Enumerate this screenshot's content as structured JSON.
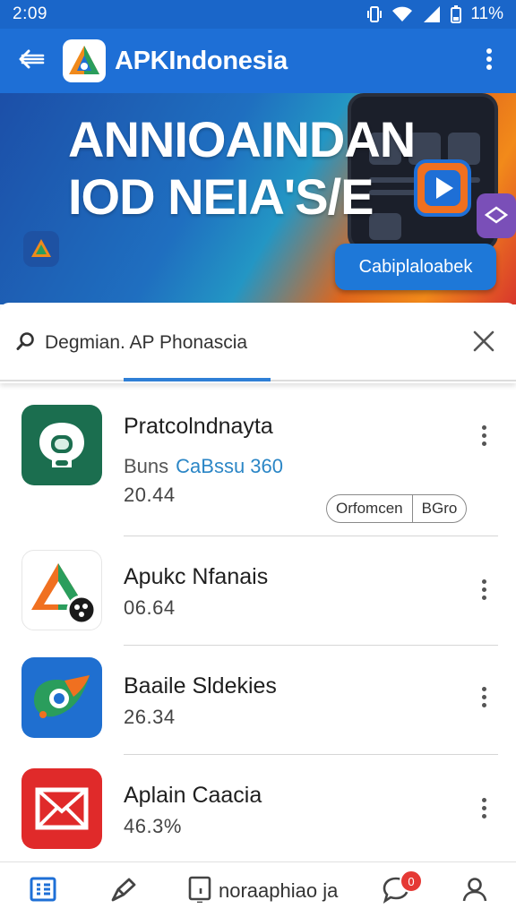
{
  "status_bar": {
    "time": "2:09",
    "battery": "11%"
  },
  "app_bar": {
    "title": "APKIndonesia"
  },
  "banner": {
    "headline_line1": "ANNIOAINDAN",
    "headline_line2": "IOD NEIA'S/E",
    "cta_label": "Cabiplaloabek"
  },
  "search": {
    "value": "Degmian. AP Phonascia"
  },
  "apps": [
    {
      "name": "Pratcolndnayta",
      "publisher": "Buns",
      "tag": "CaBssu 360",
      "size": "20.44",
      "chip_left": "Orfomcen",
      "chip_right": "BGro"
    },
    {
      "name": "Apukc Nfanais",
      "size": "06.64"
    },
    {
      "name": "Baaile Sldekies",
      "size": "26.34"
    },
    {
      "name": "Aplain Caacia",
      "size": "46.3%"
    }
  ],
  "bottom_nav": {
    "label": "noraaphiao ja",
    "badge": "0"
  },
  "colors": {
    "primary": "#1e6fd6",
    "accent": "#2b86c6",
    "badge": "#e53935"
  }
}
